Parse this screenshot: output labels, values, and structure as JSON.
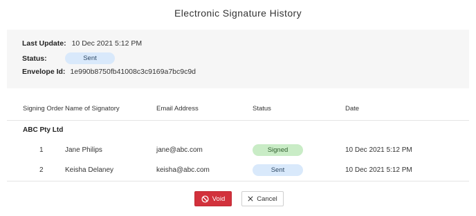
{
  "dialog": {
    "title": "Electronic Signature History"
  },
  "info": {
    "last_update_label": "Last Update:",
    "last_update_value": "10 Dec 2021 5:12 PM",
    "status_label": "Status:",
    "status_value": "Sent",
    "envelope_label": "Envelope Id:",
    "envelope_value": "1e990b8750fb41008c3c9169a7bc9c9d"
  },
  "table": {
    "headers": [
      "Signing Order",
      "Name of Signatory",
      "Email Address",
      "Status",
      "Date"
    ],
    "group": "ABC Pty Ltd",
    "rows": [
      {
        "order": "1",
        "name": "Jane Philips",
        "email": "jane@abc.com",
        "status": "Signed",
        "date": "10 Dec 2021 5:12 PM"
      },
      {
        "order": "2",
        "name": "Keisha Delaney",
        "email": "keisha@abc.com",
        "status": "Sent",
        "date": "10 Dec 2021 5:12 PM"
      }
    ]
  },
  "buttons": {
    "void_label": "Void",
    "cancel_label": "Cancel"
  },
  "colors": {
    "void": "#d2313c",
    "signed_pill": "#c9ecc6",
    "sent_pill": "#d9e9fb",
    "panel_bg": "#f6f6f6"
  },
  "icons": {
    "void": "ban-icon",
    "cancel": "close-icon"
  }
}
